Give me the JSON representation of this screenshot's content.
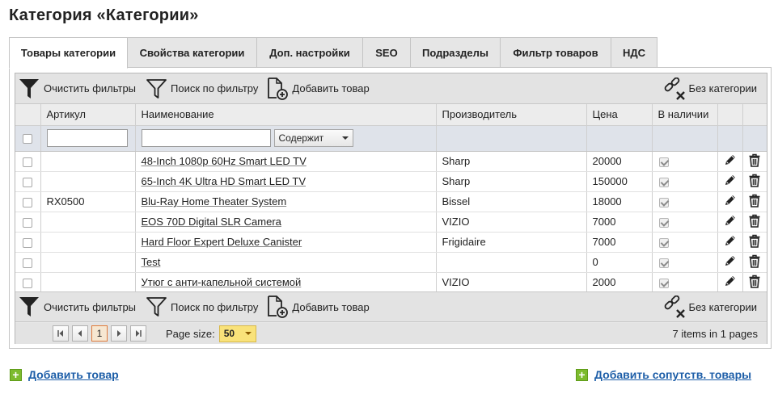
{
  "page": {
    "title": "Категория «Категории»"
  },
  "tabs": [
    {
      "label": "Товары категории",
      "active": true
    },
    {
      "label": "Свойства категории",
      "active": false
    },
    {
      "label": "Доп. настройки",
      "active": false
    },
    {
      "label": "SEO",
      "active": false
    },
    {
      "label": "Подразделы",
      "active": false
    },
    {
      "label": "Фильтр товаров",
      "active": false
    },
    {
      "label": "НДС",
      "active": false
    }
  ],
  "toolbar": {
    "clear_filters": "Очистить фильтры",
    "search_by_filter": "Поиск по фильтру",
    "add_product": "Добавить товар",
    "no_category": "Без категории"
  },
  "table": {
    "columns": {
      "article": "Артикул",
      "name": "Наименование",
      "manufacturer": "Производитель",
      "price": "Цена",
      "in_stock": "В наличии"
    },
    "filter": {
      "article_value": "",
      "name_value": "",
      "name_condition": "Содержит"
    },
    "rows": [
      {
        "selected": false,
        "article": "",
        "name": "48-Inch 1080p 60Hz Smart LED TV",
        "manufacturer": "Sharp",
        "price": "20000",
        "in_stock": true
      },
      {
        "selected": false,
        "article": "",
        "name": "65-Inch 4K Ultra HD Smart LED TV",
        "manufacturer": "Sharp",
        "price": "150000",
        "in_stock": true
      },
      {
        "selected": false,
        "article": "RX0500",
        "name": "Blu-Ray Home Theater System",
        "manufacturer": "Bissel",
        "price": "18000",
        "in_stock": true
      },
      {
        "selected": false,
        "article": "",
        "name": "EOS 70D Digital SLR Camera",
        "manufacturer": "VIZIO",
        "price": "7000",
        "in_stock": true
      },
      {
        "selected": false,
        "article": "",
        "name": "Hard Floor Expert Deluxe Canister",
        "manufacturer": "Frigidaire",
        "price": "7000",
        "in_stock": true
      },
      {
        "selected": false,
        "article": "",
        "name": "Test",
        "manufacturer": "",
        "price": "0",
        "in_stock": true
      },
      {
        "selected": false,
        "article": "",
        "name": "Утюг с анти-капельной системой",
        "manufacturer": "VIZIO",
        "price": "2000",
        "in_stock": true
      }
    ]
  },
  "pager": {
    "current_page": "1",
    "page_size_label": "Page size:",
    "page_size": "50",
    "items_info": "7 items in 1 pages"
  },
  "footer": {
    "add_product": "Добавить товар",
    "add_related": "Добавить сопутств. товары"
  },
  "colors": {
    "link": "#1d5ea8",
    "plus_icon": "#7dbb2e",
    "page_size_bg": "#f9e27a",
    "filter_row_bg": "#dfe3ea",
    "current_page_border": "#e07b3c"
  }
}
